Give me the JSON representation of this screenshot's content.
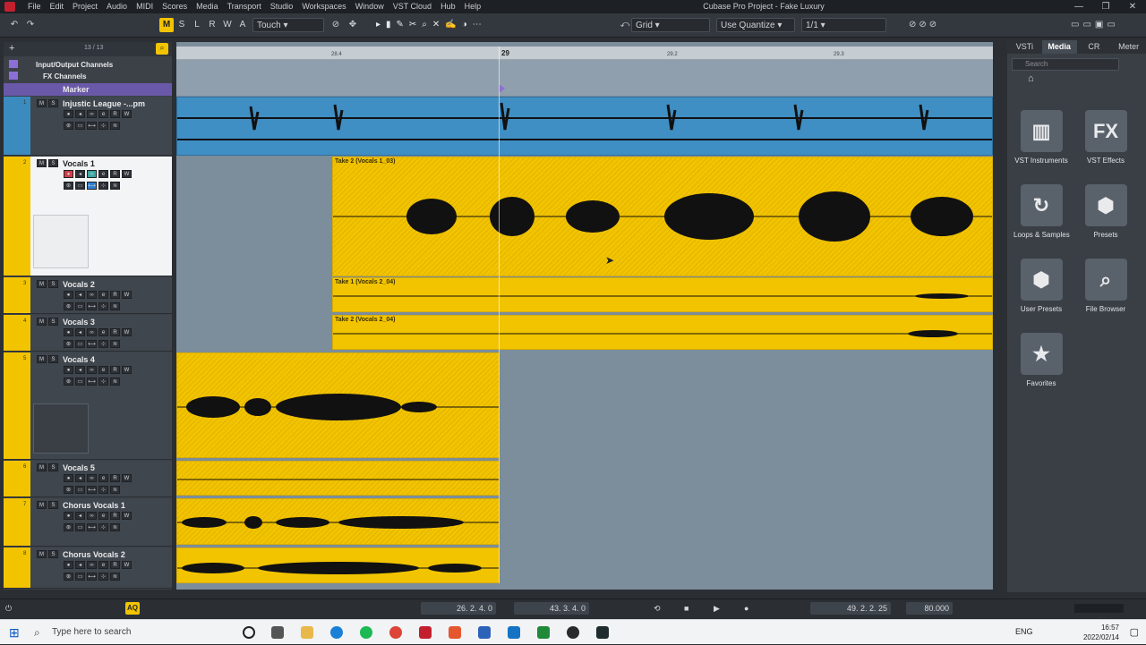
{
  "window": {
    "title": "Cubase Pro Project - Fake Luxury",
    "menu": [
      "File",
      "Edit",
      "Project",
      "Audio",
      "MIDI",
      "Scores",
      "Media",
      "Transport",
      "Studio",
      "Workspaces",
      "Window",
      "VST Cloud",
      "Hub",
      "Help"
    ],
    "controls": [
      "—",
      "❐",
      "✕"
    ]
  },
  "toolbar": {
    "buttons": [
      "M",
      "S",
      "L",
      "R",
      "W",
      "A"
    ],
    "automation_mode": "Touch",
    "snap_type": "Grid",
    "quantize_mode": "Use Quantize",
    "quantize_value": "1/1"
  },
  "tracklist": {
    "count": "13 / 13",
    "folders": [
      "Input/Output Channels",
      "FX Channels",
      "Marker"
    ],
    "tracks": [
      {
        "num": "1",
        "name": "Injustic League -...pm",
        "color": "#3c8bbf"
      },
      {
        "num": "2",
        "name": "Vocals 1",
        "color": "#f2c400"
      },
      {
        "num": "3",
        "name": "Vocals 2",
        "color": "#f2c400"
      },
      {
        "num": "4",
        "name": "Vocals 3",
        "color": "#f2c400"
      },
      {
        "num": "5",
        "name": "Vocals 4",
        "color": "#f2c400"
      },
      {
        "num": "6",
        "name": "Vocals 5",
        "color": "#f2c400"
      },
      {
        "num": "7",
        "name": "Chorus Vocals 1",
        "color": "#f2c400"
      },
      {
        "num": "8",
        "name": "Chorus Vocals 2",
        "color": "#f2c400"
      }
    ]
  },
  "ruler": {
    "ticks": [
      "28.4",
      "29",
      "29.2",
      "29.3"
    ]
  },
  "events": {
    "take2_vocals1": "Take 2 (Vocals 1_03)",
    "take1_vocals2": "Take 1 (Vocals 2_04)",
    "take2_vocals2": "Take 2 (Vocals 2_04)"
  },
  "rightzone": {
    "tabs": [
      "VSTi",
      "Media",
      "CR",
      "Meter"
    ],
    "active_tab": "Media",
    "search_placeholder": "Search",
    "tiles": [
      {
        "label": "VST Instruments",
        "icon": "piano-keys-icon",
        "glyph": "▥"
      },
      {
        "label": "VST Effects",
        "icon": "fx-icon",
        "glyph": "FX"
      },
      {
        "label": "Loops & Samples",
        "icon": "loop-icon",
        "glyph": "↻"
      },
      {
        "label": "Presets",
        "icon": "presets-icon",
        "glyph": "⬢"
      },
      {
        "label": "User Presets",
        "icon": "user-presets-icon",
        "glyph": "⬢"
      },
      {
        "label": "File Browser",
        "icon": "file-browser-icon",
        "glyph": "⌕"
      },
      {
        "label": "Favorites",
        "icon": "star-icon",
        "glyph": "★"
      }
    ]
  },
  "transport": {
    "left_locator": "26. 2. 4.   0",
    "right_locator": "43. 3. 4.   0",
    "position": "49. 2. 2. 25",
    "tempo": "80.000",
    "aq": "AQ"
  },
  "taskbar": {
    "search_placeholder": "Type here to search",
    "language": "ENG",
    "time": "16:57",
    "date": "2022/02/14"
  }
}
